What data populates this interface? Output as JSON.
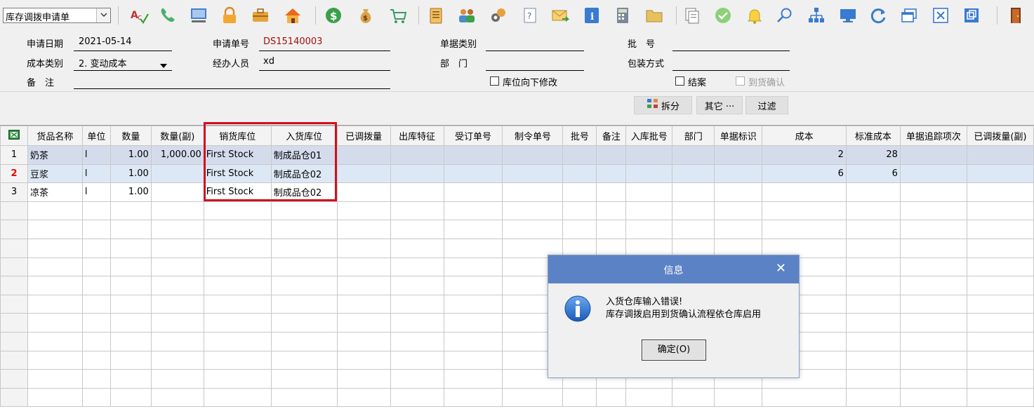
{
  "toolbar": {
    "form_select_value": "库存调拨申请单",
    "icons": [
      "spellcheck-icon",
      "phone-icon",
      "monitor-icon",
      "lock-icon",
      "briefcase-icon",
      "home-icon",
      "dollar-icon",
      "money-bag-icon",
      "cart-icon",
      "clipboard-icon",
      "users-icon",
      "link-icon",
      "help-doc-icon",
      "mail-icon",
      "info-icon",
      "calculator-icon",
      "folder-icon",
      "copy-icon",
      "check-icon",
      "bell-icon",
      "search-icon",
      "org-chart-icon",
      "screen-icon",
      "refresh-icon",
      "window-icon",
      "close-box-icon",
      "restore-icon",
      "exit-door-icon"
    ]
  },
  "header": {
    "apply_date_label": "申请日期",
    "apply_date_value": "2021-05-14",
    "apply_no_label": "申请单号",
    "apply_no_value": "DS15140003",
    "doc_type_label": "单据类别",
    "batch_label": "批　号",
    "cost_type_label": "成本类别",
    "cost_type_value": "2. 变动成本",
    "handler_label": "经办人员",
    "handler_value": "xd",
    "dept_label": "部　门",
    "pack_label": "包装方式",
    "remark_label": "备　注",
    "location_down_label": "库位向下修改",
    "close_label": "结案",
    "arrival_confirm_label": "到货确认"
  },
  "actions": {
    "split_label": "拆分",
    "other_label": "其它 ···",
    "filter_label": "过滤"
  },
  "grid": {
    "columns": [
      "货品名称",
      "单位",
      "数量",
      "数量(副)",
      "销货库位",
      "入货库位",
      "已调拨量",
      "出库特征",
      "受订单号",
      "制令单号",
      "批号",
      "备注",
      "入库批号",
      "部门",
      "单据标识",
      "成本",
      "标准成本",
      "单据追踪项次",
      "已调拨量(副)"
    ],
    "rows": [
      {
        "no": "1",
        "name": "奶茶",
        "unit": "l",
        "qty": "1.00",
        "qty2": "1,000.00",
        "out_loc": "First Stock",
        "in_loc": "制成品仓01",
        "cost": "2",
        "std_cost": "28"
      },
      {
        "no": "2",
        "name": "豆浆",
        "unit": "l",
        "qty": "1.00",
        "qty2": "",
        "out_loc": "First Stock",
        "in_loc": "制成品仓02",
        "cost": "6",
        "std_cost": "6"
      },
      {
        "no": "3",
        "name": "凉茶",
        "unit": "l",
        "qty": "1.00",
        "qty2": "",
        "out_loc": "First Stock",
        "in_loc": "制成品仓02",
        "cost": "",
        "std_cost": ""
      }
    ]
  },
  "dialog": {
    "title": "信息",
    "message_line1": "入货仓库输入错误!",
    "message_line2": "库存调拨启用到货确认流程依仓库启用",
    "ok_label": "确定(O)"
  },
  "colors": {
    "dialog_title_bg": "#5b82c4",
    "highlight_border": "#d01020",
    "selected_row": "#d4dcec",
    "apply_no_color": "#a01010"
  }
}
